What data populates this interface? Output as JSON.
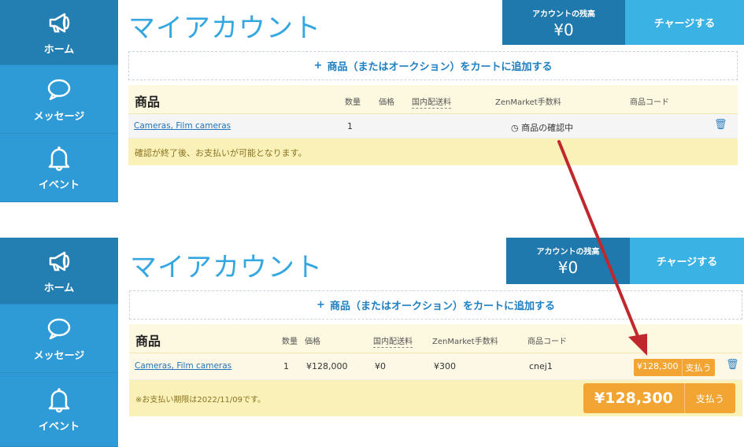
{
  "nav": {
    "home": "ホーム",
    "messages": "メッセージ",
    "events": "イベント"
  },
  "top": {
    "title": "マイアカウント",
    "balance_label": "アカウントの残高",
    "balance_amount": "¥0",
    "charge_label": "チャージする",
    "add_label": "商品（またはオークション）をカートに追加する",
    "table": {
      "h_product": "商品",
      "h_qty": "数量",
      "h_price": "価格",
      "h_shipping": "国内配送料",
      "h_fee": "ZenMarket手数料",
      "h_code": "商品コード",
      "row_name": "Cameras, Film cameras",
      "row_qty": "1",
      "row_status": "商品の確認中",
      "note": "確認が終了後、お支払いが可能となります。"
    }
  },
  "bottom": {
    "title": "マイアカウント",
    "balance_label": "アカウントの残高",
    "balance_amount": "¥0",
    "charge_label": "チャージする",
    "add_label": "商品（またはオークション）をカートに追加する",
    "table": {
      "h_product": "商品",
      "h_qty": "数量",
      "h_price": "価格",
      "h_shipping": "国内配送料",
      "h_fee": "ZenMarket手数料",
      "h_code": "商品コード",
      "row_name": "Cameras, Film cameras",
      "row_qty": "1",
      "row_price": "¥128,000",
      "row_shipping": "¥0",
      "row_fee": "¥300",
      "row_code": "cnej1",
      "row_pay_amount": "¥128,300",
      "row_pay_label": "支払う",
      "note": "※お支払い期限は2022/11/09です。",
      "total_amount": "¥128,300",
      "total_pay_label": "支払う"
    }
  },
  "colors": {
    "sidebar": "#2e9bd6",
    "sidebar_active": "#237eb1",
    "title": "#35a7e0",
    "pay": "#f2a533",
    "arrow": "#c0282d"
  }
}
